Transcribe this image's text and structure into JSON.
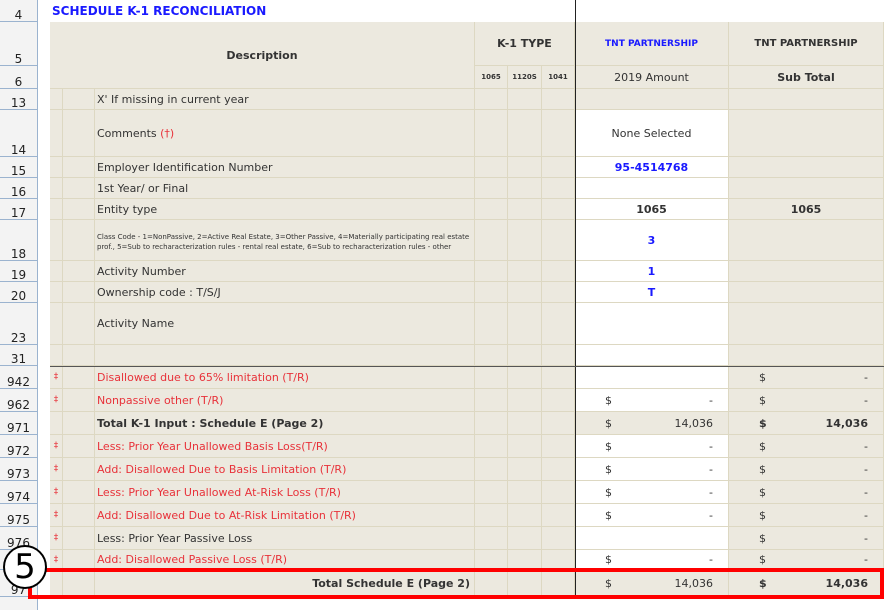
{
  "title": "SCHEDULE K-1 RECONCILIATION",
  "header": {
    "description": "Description",
    "k1_type": "K-1 TYPE",
    "k1_cols": [
      "1065",
      "1120S",
      "1041"
    ],
    "col1_name": "TNT PARTNERSHIP",
    "col1_sub": "2019 Amount",
    "col2_name": "TNT PARTNERSHIP",
    "col2_sub": "Sub Total"
  },
  "row_numbers": [
    "4",
    "5",
    "6",
    "13",
    "14",
    "15",
    "16",
    "17",
    "18",
    "19",
    "20",
    "23",
    "31",
    "942",
    "962",
    "971",
    "972",
    "973",
    "974",
    "975",
    "976",
    "",
    "97"
  ],
  "rows": [
    {
      "num": "13",
      "mark": "",
      "label": "X' If missing in current year",
      "amount": "",
      "subtotal": ""
    },
    {
      "num": "14",
      "mark": "",
      "label": "Comments",
      "label_suffix": "(†)",
      "amount": "None Selected",
      "subtotal": ""
    },
    {
      "num": "15",
      "mark": "",
      "label": "Employer Identification Number",
      "amount": "95-4514768",
      "subtotal": ""
    },
    {
      "num": "16",
      "mark": "",
      "label": "1st Year/ or Final",
      "amount": "",
      "subtotal": ""
    },
    {
      "num": "17",
      "mark": "",
      "label": "Entity type",
      "amount": "1065",
      "subtotal": "1065"
    },
    {
      "num": "18",
      "mark": "",
      "label": "Class Code - 1=NonPassive, 2=Active Real Estate, 3=Other Passive, 4=Materially participating real estate prof., 5=Sub to recharacterization rules - rental real estate, 6=Sub to recharacterization rules - other",
      "amount": "3",
      "subtotal": ""
    },
    {
      "num": "19",
      "mark": "",
      "label": "Activity Number",
      "amount": "1",
      "subtotal": ""
    },
    {
      "num": "20",
      "mark": "",
      "label": "Ownership code : T/S/J",
      "amount": "T",
      "subtotal": ""
    },
    {
      "num": "23",
      "mark": "",
      "label": "Activity Name",
      "amount": "",
      "subtotal": ""
    },
    {
      "num": "31",
      "mark": "",
      "label": "",
      "amount": "",
      "subtotal": ""
    },
    {
      "num": "942",
      "mark": "‡",
      "label": "Disallowed due to 65% limitation (T/R)",
      "amount_sign": "",
      "amount": "",
      "sub_sign": "$",
      "subtotal": "-"
    },
    {
      "num": "962",
      "mark": "‡",
      "label": "Nonpassive other (T/R)",
      "amount_sign": "$",
      "amount": "-",
      "sub_sign": "$",
      "subtotal": "-"
    },
    {
      "num": "971",
      "mark": "",
      "label": "Total K-1 Input : Schedule E (Page 2)",
      "amount_sign": "$",
      "amount": "14,036",
      "sub_sign": "$",
      "subtotal": "14,036"
    },
    {
      "num": "972",
      "mark": "‡",
      "label": "Less: Prior Year Unallowed Basis Loss(T/R)",
      "amount_sign": "$",
      "amount": "-",
      "sub_sign": "$",
      "subtotal": "-"
    },
    {
      "num": "973",
      "mark": "‡",
      "label": "Add: Disallowed Due to Basis Limitation (T/R)",
      "amount_sign": "$",
      "amount": "-",
      "sub_sign": "$",
      "subtotal": "-"
    },
    {
      "num": "974",
      "mark": "‡",
      "label": "Less: Prior Year Unallowed At-Risk Loss (T/R)",
      "amount_sign": "$",
      "amount": "-",
      "sub_sign": "$",
      "subtotal": "-"
    },
    {
      "num": "975",
      "mark": "‡",
      "label": "Add: Disallowed Due to At-Risk Limitation (T/R)",
      "amount_sign": "$",
      "amount": "-",
      "sub_sign": "$",
      "subtotal": "-"
    },
    {
      "num": "976",
      "mark": "‡",
      "label": "Less: Prior Year Passive Loss",
      "amount_sign": "",
      "amount": "",
      "sub_sign": "$",
      "subtotal": "-"
    },
    {
      "num": "",
      "mark": "‡",
      "label": "Add: Disallowed Passive Loss (T/R)",
      "amount_sign": "$",
      "amount": "-",
      "sub_sign": "$",
      "subtotal": "-"
    },
    {
      "num": "97",
      "mark": "",
      "label": "Total Schedule E (Page 2)",
      "amount_sign": "$",
      "amount": "14,036",
      "sub_sign": "$",
      "subtotal": "14,036"
    }
  ],
  "annotation": "5"
}
